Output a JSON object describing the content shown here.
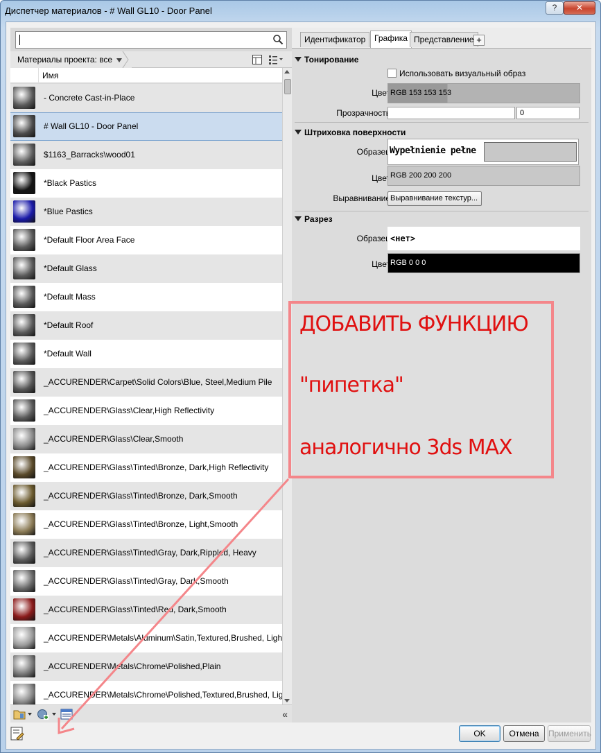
{
  "window": {
    "title": "Диспетчер материалов - # Wall GL10 - Door Panel",
    "help_label": "?",
    "close_label": "✕"
  },
  "left_panel": {
    "search_value": "",
    "filter_label": "Материалы проекта: все",
    "column_header": "Имя",
    "materials": [
      {
        "name": "- Concrete Cast-in-Place",
        "thumb": "#5a5a5a",
        "selected": false
      },
      {
        "name": "# Wall GL10 - Door Panel",
        "thumb": "#4c4c4c",
        "selected": true
      },
      {
        "name": "$1163_Barracks\\wood01",
        "thumb": "#5e5e5e",
        "selected": false
      },
      {
        "name": "*Black Pastics",
        "thumb": "#141414",
        "selected": false
      },
      {
        "name": "*Blue Pastics",
        "thumb": "#1a1aa8",
        "selected": false
      },
      {
        "name": "*Default Floor Area Face",
        "thumb": "#5a5a5a",
        "selected": false
      },
      {
        "name": "*Default Glass",
        "thumb": "#5a5a5a",
        "selected": false
      },
      {
        "name": "*Default Mass",
        "thumb": "#5a5a5a",
        "selected": false
      },
      {
        "name": "*Default Roof",
        "thumb": "#5a5a5a",
        "selected": false
      },
      {
        "name": "*Default Wall",
        "thumb": "#5a5a5a",
        "selected": false
      },
      {
        "name": "_ACCURENDER\\Carpet\\Solid Colors\\Blue, Steel,Medium Pile",
        "thumb": "#555555",
        "selected": false
      },
      {
        "name": "_ACCURENDER\\Glass\\Clear,High Reflectivity",
        "thumb": "#5a5a5a",
        "selected": false
      },
      {
        "name": "_ACCURENDER\\Glass\\Clear,Smooth",
        "thumb": "#8a8a8a",
        "selected": false
      },
      {
        "name": "_ACCURENDER\\Glass\\Tinted\\Bronze, Dark,High Reflectivity",
        "thumb": "#5a4a2a",
        "selected": false
      },
      {
        "name": "_ACCURENDER\\Glass\\Tinted\\Bronze, Dark,Smooth",
        "thumb": "#6b5a2e",
        "selected": false
      },
      {
        "name": "_ACCURENDER\\Glass\\Tinted\\Bronze, Light,Smooth",
        "thumb": "#8a7a55",
        "selected": false
      },
      {
        "name": "_ACCURENDER\\Glass\\Tinted\\Gray, Dark,Rippled, Heavy",
        "thumb": "#5a5a5a",
        "selected": false
      },
      {
        "name": "_ACCURENDER\\Glass\\Tinted\\Gray, Dark,Smooth",
        "thumb": "#6a6a6a",
        "selected": false
      },
      {
        "name": "_ACCURENDER\\Glass\\Tinted\\Red, Dark,Smooth",
        "thumb": "#8a1a1a",
        "selected": false
      },
      {
        "name": "_ACCURENDER\\Metals\\Aluminum\\Satin,Textured,Brushed, Light",
        "thumb": "#9a9a9a",
        "selected": false
      },
      {
        "name": "_ACCURENDER\\Metals\\Chrome\\Polished,Plain",
        "thumb": "#7a7a7a",
        "selected": false
      },
      {
        "name": "_ACCURENDER\\Metals\\Chrome\\Polished,Textured,Brushed, Light",
        "thumb": "#888888",
        "selected": false
      }
    ]
  },
  "tabs": [
    {
      "label": "Идентификатор",
      "active": false
    },
    {
      "label": "Графика",
      "active": true
    },
    {
      "label": "Представление",
      "active": false
    }
  ],
  "tab_add_label": "+",
  "shading": {
    "title": "Тонирование",
    "use_render_label": "Использовать визуальный образ",
    "use_render_checked": false,
    "color_label": "Цвет",
    "color_value": "RGB 153 153 153",
    "color_hex": "#999999",
    "transparency_label": "Прозрачность",
    "transparency_value": "0"
  },
  "surface_pattern": {
    "title": "Штриховка поверхности",
    "pattern_label": "Образец",
    "pattern_value": "Wypełnienie pełne",
    "color_label": "Цвет",
    "color_value": "RGB 200 200 200",
    "color_hex": "#c8c8c8",
    "alignment_label": "Выравнивание",
    "alignment_button": "Выравнивание текстур..."
  },
  "cut_pattern": {
    "title": "Разрез",
    "pattern_label": "Образец",
    "pattern_value": "<нет>",
    "color_label": "Цвет",
    "color_value": "RGB 0 0 0",
    "color_hex": "#000000"
  },
  "annotation": {
    "line1": "ДОБАВИТЬ ФУНКЦИЮ",
    "line2": "\"пипетка\"",
    "line3": "аналогично 3ds MAX"
  },
  "footer": {
    "ok_label": "OK",
    "cancel_label": "Отмена",
    "apply_label": "Применить"
  }
}
